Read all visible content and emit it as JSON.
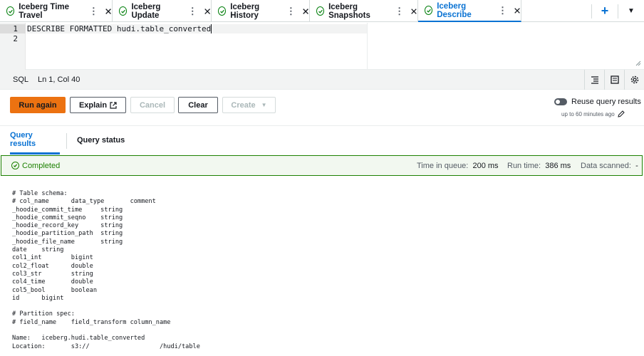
{
  "tabs": [
    {
      "label": "Iceberg Time Travel"
    },
    {
      "label": "Iceberg Update"
    },
    {
      "label": "Iceberg History"
    },
    {
      "label": "Iceberg Snapshots"
    },
    {
      "label": "Iceberg Describe"
    }
  ],
  "active_tab": "Iceberg Describe",
  "editor": {
    "line_numbers": [
      "1",
      "2"
    ],
    "query_keywords": "DESCRIBE FORMATTED",
    "query_table": "hudi.table_converted"
  },
  "statusline": {
    "language": "SQL",
    "cursor": "Ln 1, Col 40"
  },
  "actions": {
    "run_again": "Run again",
    "explain": "Explain",
    "cancel": "Cancel",
    "clear": "Clear",
    "create": "Create"
  },
  "reuse": {
    "label": "Reuse query results",
    "sub": "up to 60 minutes ago"
  },
  "result_tabs": {
    "results": "Query results",
    "status": "Query status"
  },
  "run_status": {
    "state": "Completed",
    "queue_label": "Time in queue:",
    "queue_value": "200 ms",
    "runtime_label": "Run time:",
    "runtime_value": "386 ms",
    "scanned_label": "Data scanned:",
    "scanned_value": "-"
  },
  "output": {
    "lines": [
      "# Table schema:",
      "# col_name      data_type       comment",
      "_hoodie_commit_time     string",
      "_hoodie_commit_seqno    string",
      "_hoodie_record_key      string",
      "_hoodie_partition_path  string",
      "_hoodie_file_name       string",
      "date    string",
      "col1_int        bigint",
      "col2_float      double",
      "col3_str        string",
      "col4_time       double",
      "col5_bool       boolean",
      "id      bigint",
      "",
      "# Partition spec:",
      "# field_name    field_transform column_name",
      "",
      "Name:   iceberg.hudi.table_converted",
      "Location:       s3://                   /hudi/table"
    ]
  },
  "colors": {
    "accent": "#0972d3",
    "primary_button": "#ec7211",
    "success": "#1d8102"
  }
}
